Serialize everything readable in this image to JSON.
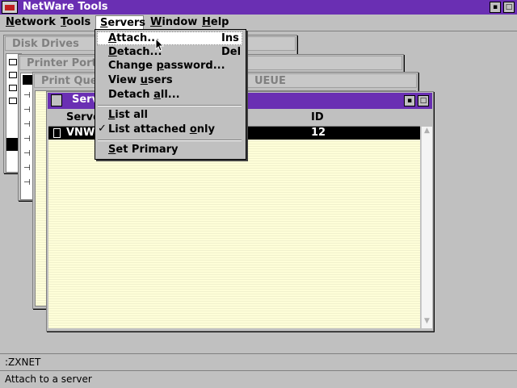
{
  "app": {
    "title": "NetWare Tools"
  },
  "menubar": {
    "items": [
      {
        "label": "Network",
        "accel": "N",
        "rest": "etwork"
      },
      {
        "label": "Tools",
        "accel": "T",
        "rest": "ools"
      },
      {
        "label": "Servers",
        "accel": "S",
        "rest": "ervers"
      },
      {
        "label": "Window",
        "accel": "W",
        "rest": "indow"
      },
      {
        "label": "Help",
        "accel": "H",
        "rest": "elp"
      }
    ]
  },
  "windows": {
    "disk_drives": {
      "title": "Disk Drives"
    },
    "printer_ports": {
      "title": "Printer Ports"
    },
    "print_queue": {
      "title": "Print Queu",
      "title_tail": "UEUE"
    },
    "servers": {
      "title": "Serv",
      "columns": {
        "server": "Serve",
        "id": "ID"
      },
      "rows": [
        {
          "server": "VNW4",
          "id": "12"
        }
      ]
    }
  },
  "servers_menu": {
    "items": [
      {
        "label": "Attach...",
        "accel": "A",
        "rest": "ttach...",
        "shortcut": "Ins"
      },
      {
        "label": "Detach...",
        "accel": "D",
        "rest": "etach...",
        "shortcut": "Del"
      },
      {
        "label": "Change password...",
        "pre": "Change ",
        "accel": "p",
        "rest": "assword..."
      },
      {
        "label": "View users",
        "pre": "View ",
        "accel": "u",
        "rest": "sers"
      },
      {
        "label": "Detach all...",
        "pre": "Detach ",
        "accel": "a",
        "rest": "ll..."
      },
      {
        "label": "List all",
        "accel": "L",
        "rest": "ist all"
      },
      {
        "label": "List attached only",
        "pre": "List attached ",
        "accel": "o",
        "rest": "nly",
        "checked": true
      },
      {
        "label": "Set Primary",
        "accel": "S",
        "rest": "et Primary"
      }
    ],
    "check_glyph": "✓"
  },
  "status": {
    "context": ":ZXNET",
    "hint": "Attach to a server"
  }
}
